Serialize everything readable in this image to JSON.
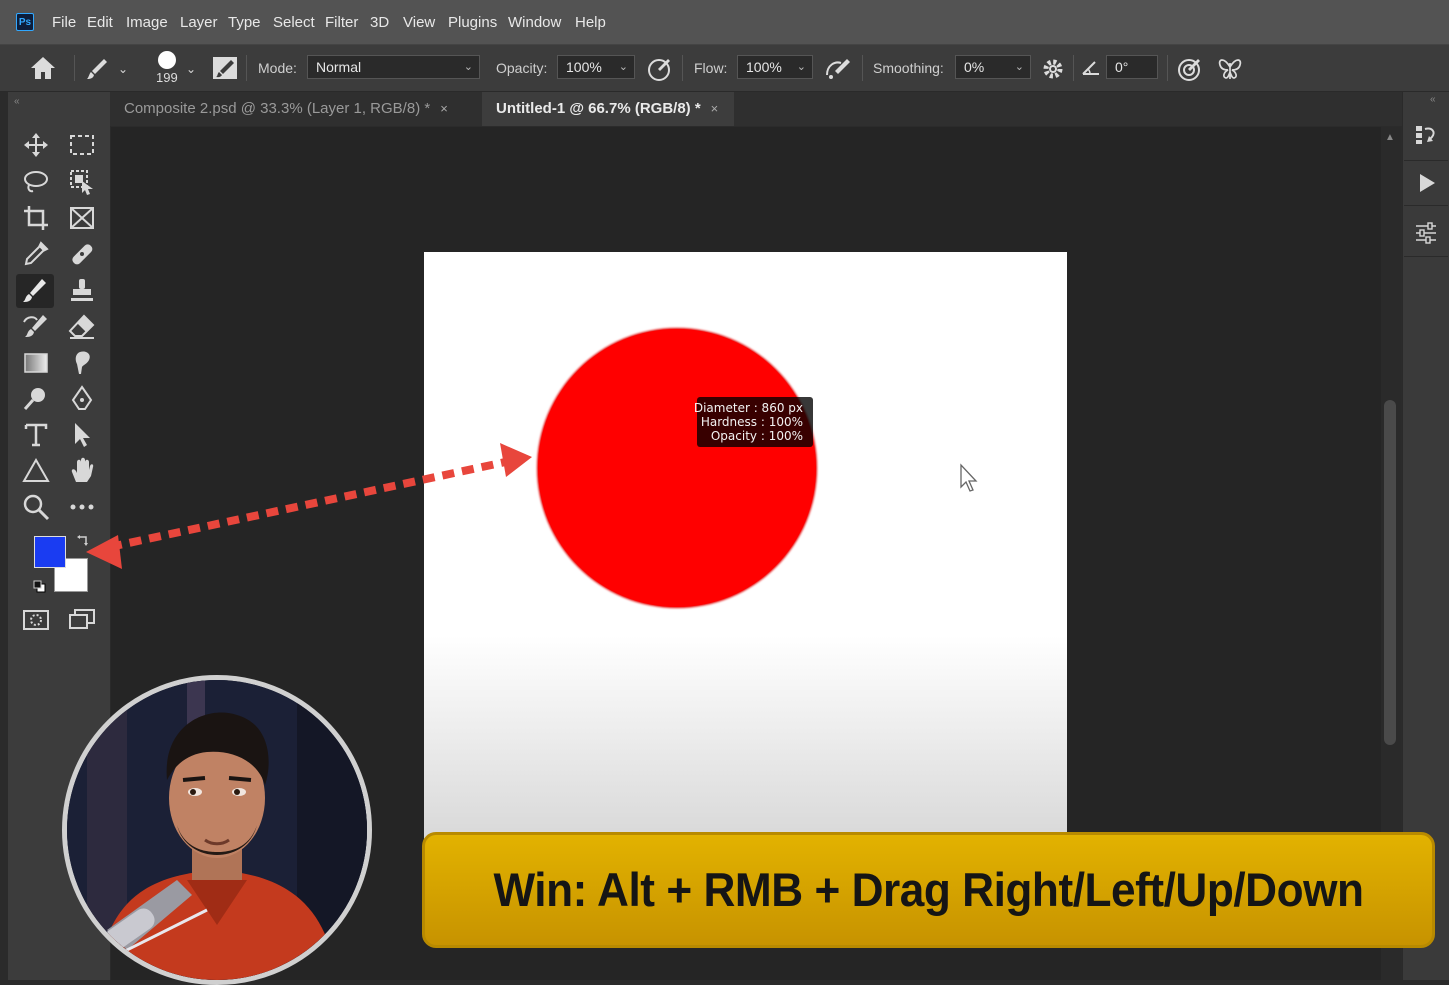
{
  "app": {
    "logo": "Ps"
  },
  "menu": [
    "File",
    "Edit",
    "Image",
    "Layer",
    "Type",
    "Select",
    "Filter",
    "3D",
    "View",
    "Plugins",
    "Window",
    "Help"
  ],
  "options": {
    "brush_size": "199",
    "mode_label": "Mode:",
    "mode_value": "Normal",
    "opacity_label": "Opacity:",
    "opacity_value": "100%",
    "flow_label": "Flow:",
    "flow_value": "100%",
    "smoothing_label": "Smoothing:",
    "smoothing_value": "0%",
    "angle_value": "0°"
  },
  "tabs": [
    {
      "label": "Composite 2.psd @ 33.3% (Layer 1, RGB/8) *",
      "active": false
    },
    {
      "label": "Untitled-1 @ 66.7% (RGB/8) *",
      "active": true
    }
  ],
  "tooltip": {
    "diameter": "Diameter :  860 px",
    "hardness": "Hardness :    100%",
    "opacity": "Opacity :    100%"
  },
  "colors": {
    "foreground": "#1a3cf2",
    "background": "#ffffff",
    "brush": "#ff0000",
    "arrow": "#e8463c",
    "caption_bg": "#d9a800"
  },
  "caption": "Win: Alt + RMB + Drag Right/Left/Up/Down",
  "icons": {
    "collapse_left": "«",
    "collapse_right": "«",
    "close": "×",
    "chevron": "⌄"
  }
}
